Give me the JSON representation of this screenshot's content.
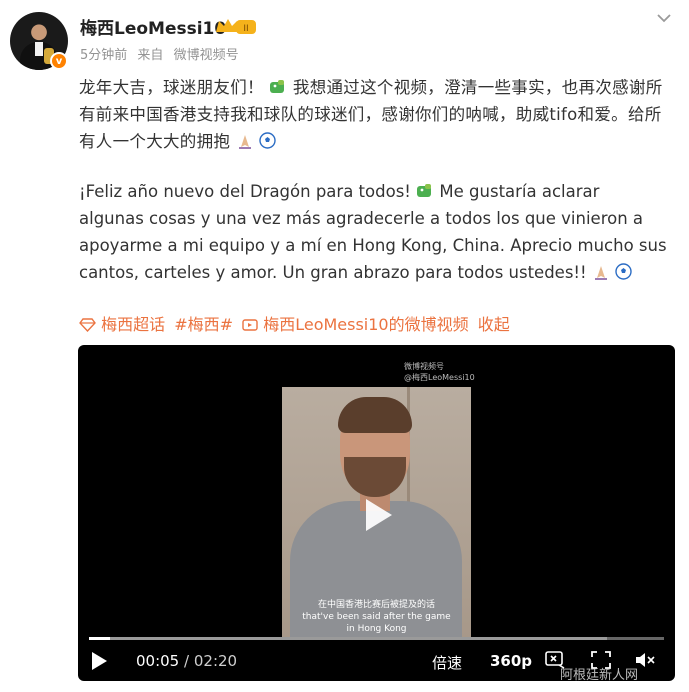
{
  "post": {
    "username": "梅西LeoMessi10",
    "badge_level": "II",
    "time": "5分钟前",
    "source_prefix": "来自",
    "source": "微博视频号",
    "text_cn_1": "龙年大吉，球迷朋友们！",
    "text_cn_2": "我想通过这个视频，澄清一些事实，也再次感谢所有前来中国香港支持我和球队的球迷们，感谢你们的呐喊，助威tifo和爱。给所有人一个大大的拥抱",
    "text_es_1": "¡Feliz año nuevo del Dragón para todos!",
    "text_es_2": "Me gustaría aclarar algunas cosas y una vez más agradecerle a todos los que vinieron a apoyarme a mi equipo y a mí en Hong Kong, China. Aprecio mucho sus cantos, carteles y amor. Un gran abrazo para todos ustedes!!",
    "topic_1": "梅西超话",
    "topic_2": "#梅西#",
    "video_link": "梅西LeoMessi10的微博视频",
    "collapse": "收起"
  },
  "video": {
    "watermark_line1": "微博视频号",
    "watermark_line2": "@梅西LeoMessi10",
    "subtitle_cn": "在中国香港比赛后被提及的话",
    "subtitle_en": "that've been said after the game",
    "subtitle_en_2": "in Hong Kong",
    "current_time": "00:05",
    "separator": "/",
    "duration": "02:20",
    "progress_fraction": 0.036,
    "buffered_fraction": 0.9,
    "speed_label": "倍速",
    "quality_label": "360p"
  },
  "watermark_site": "阿根廷新人网",
  "colors": {
    "accent": "#eb7340",
    "video_bg": "#000000",
    "badge": "#ff8200"
  }
}
